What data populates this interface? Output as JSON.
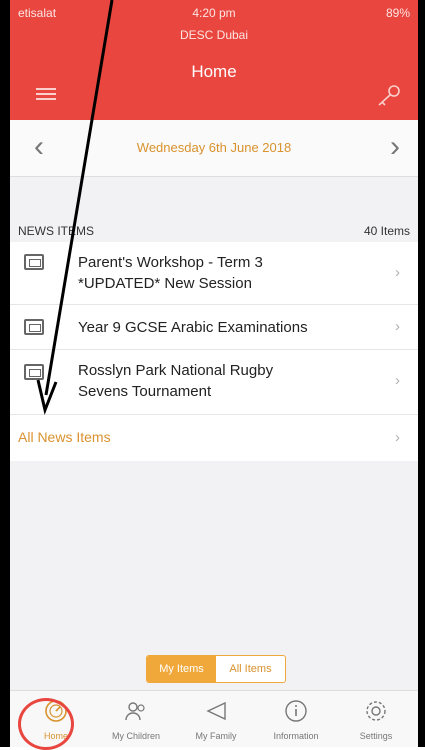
{
  "status": {
    "carrier": "etisalat",
    "time": "4:20 pm",
    "battery": "89%"
  },
  "header": {
    "subtitle": "DESC Dubai",
    "title": "Home"
  },
  "datebar": {
    "date": "Wednesday 6th June 2018"
  },
  "news": {
    "section_label": "NEWS ITEMS",
    "count": "40 Items",
    "items": [
      {
        "line1": "Parent's Workshop - Term 3",
        "line2": "*UPDATED* New Session"
      },
      {
        "line1": "Year 9 GCSE Arabic Examinations",
        "line2": ""
      },
      {
        "line1": "Rosslyn Park National Rugby",
        "line2": "Sevens Tournament"
      }
    ],
    "all_label": "All News Items"
  },
  "segment": {
    "my_items": "My Items",
    "all_items": "All Items"
  },
  "tabs": [
    {
      "label": "Home",
      "icon": "gauge-icon"
    },
    {
      "label": "My Children",
      "icon": "children-icon"
    },
    {
      "label": "My Family",
      "icon": "megaphone-icon"
    },
    {
      "label": "Information",
      "icon": "info-icon"
    },
    {
      "label": "Settings",
      "icon": "gear-icon"
    }
  ],
  "colors": {
    "brand": "#e8463f",
    "accent": "#d9922e",
    "segment": "#f0a83a"
  }
}
